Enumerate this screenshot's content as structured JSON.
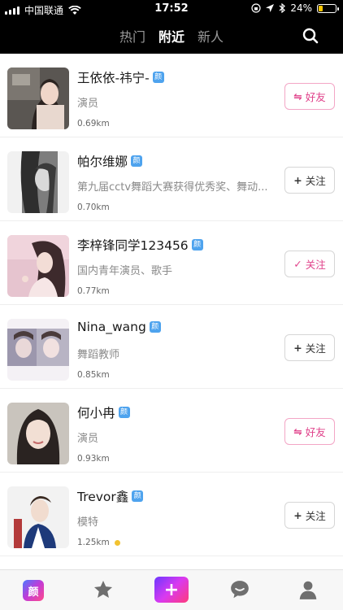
{
  "status_bar": {
    "carrier": "中国联通",
    "time": "17:52",
    "battery": "24%",
    "battery_level": 0.24
  },
  "tabs": [
    {
      "label": "热门",
      "active": false
    },
    {
      "label": "附近",
      "active": true
    },
    {
      "label": "新人",
      "active": false
    }
  ],
  "badge_char": "颜",
  "users": [
    {
      "name": "王依依-祎宁-",
      "desc": "演员",
      "distance": "0.69km",
      "action": {
        "icon": "⇋",
        "label": "好友",
        "type": "friend"
      },
      "online": false
    },
    {
      "name": "帕尔维娜",
      "desc": "第九届cctv舞蹈大赛获得优秀奖、舞动...",
      "distance": "0.70km",
      "action": {
        "icon": "+",
        "label": "关注",
        "type": "follow"
      },
      "online": false
    },
    {
      "name": "李梓锋同学123456",
      "desc": "国内青年演员、歌手",
      "distance": "0.77km",
      "action": {
        "icon": "✓",
        "label": "关注",
        "type": "followed"
      },
      "online": false
    },
    {
      "name": "Nina_wang",
      "desc": "舞蹈教师",
      "distance": "0.85km",
      "action": {
        "icon": "+",
        "label": "关注",
        "type": "follow"
      },
      "online": false
    },
    {
      "name": "何小冉",
      "desc": "演员",
      "distance": "0.93km",
      "action": {
        "icon": "⇋",
        "label": "好友",
        "type": "friend"
      },
      "online": false
    },
    {
      "name": "Trevor鑫",
      "desc": "模特",
      "distance": "1.25km",
      "action": {
        "icon": "+",
        "label": "关注",
        "type": "follow"
      },
      "online": true
    }
  ],
  "bottom_nav": {
    "logo_char": "颜",
    "plus": "+",
    "items": [
      "app-logo",
      "star-icon",
      "plus-icon",
      "chat-icon",
      "profile-icon"
    ]
  },
  "colors": {
    "accent_pink": "#e0418a",
    "badge_blue": "#4ea3ee",
    "online_yellow": "#f2c230"
  }
}
